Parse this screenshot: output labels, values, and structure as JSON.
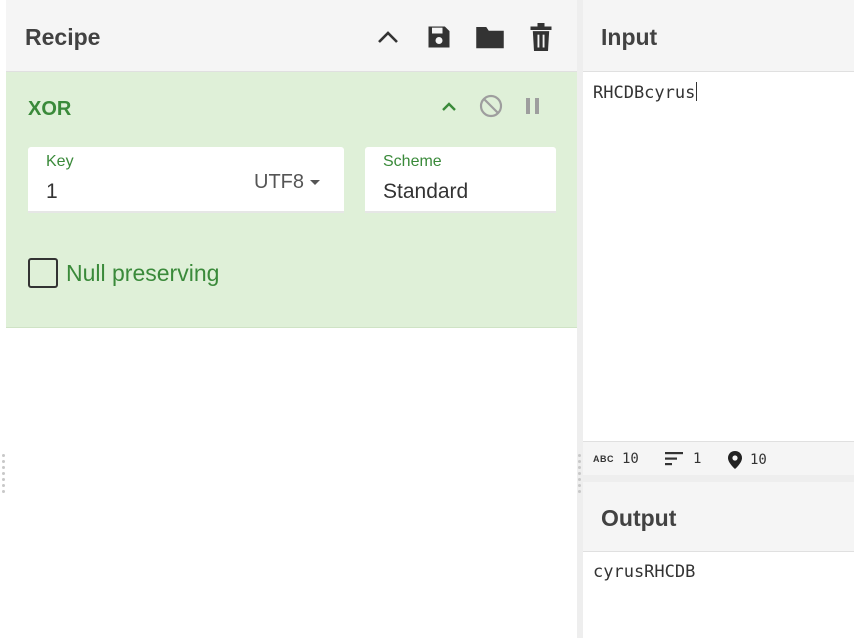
{
  "recipe": {
    "title": "Recipe",
    "icons": [
      "chevron-up-icon",
      "save-icon",
      "folder-icon",
      "trash-icon"
    ],
    "operation": {
      "name": "XOR",
      "key": {
        "label": "Key",
        "value": "1",
        "encoding": "UTF8"
      },
      "scheme": {
        "label": "Scheme",
        "value": "Standard"
      },
      "null_preserving": {
        "label": "Null preserving",
        "checked": false
      },
      "icons": [
        "chevron-up-icon",
        "disable-icon",
        "pause-icon"
      ]
    }
  },
  "input": {
    "title": "Input",
    "value": "RHCDBcyrus",
    "status": {
      "length": "10",
      "lines": "1",
      "position": "10",
      "abc_label": "ABC"
    }
  },
  "output": {
    "title": "Output",
    "value": "cyrusRHCDB"
  },
  "colors": {
    "accent_green": "#3a8a3a",
    "op_background": "#dff0d8",
    "header_bg": "#f5f5f5"
  }
}
